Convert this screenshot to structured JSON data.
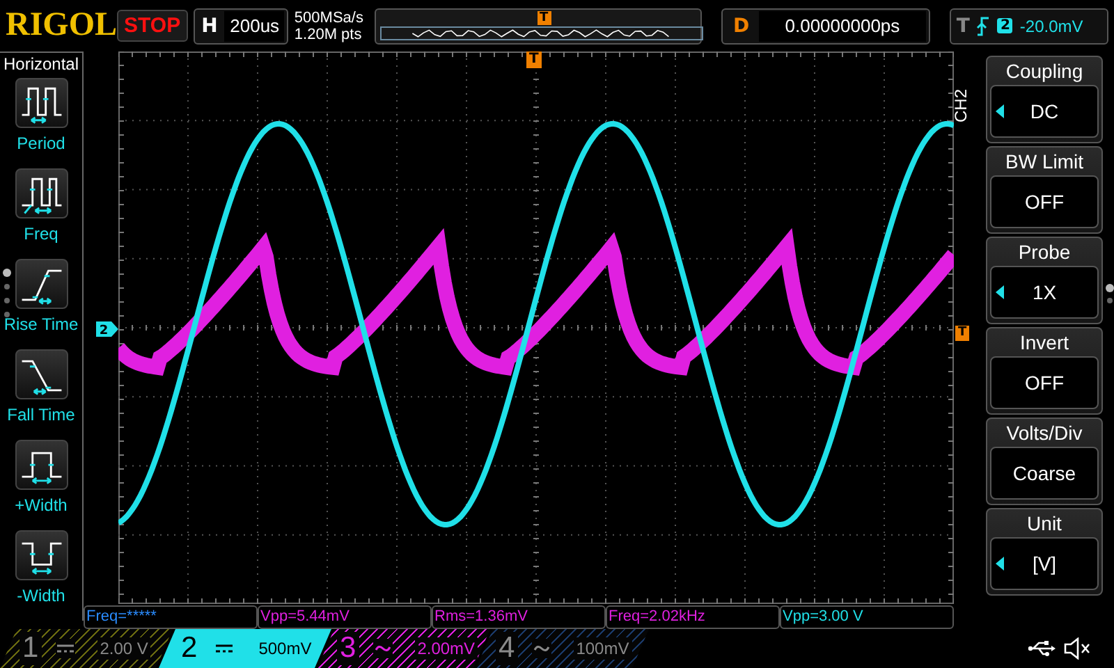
{
  "top_bar": {
    "logo": "RIGOL",
    "run_state": "STOP",
    "timebase": {
      "label": "H",
      "value": "200us"
    },
    "sample_rate": "500MSa/s",
    "memory_depth": "1.20M pts",
    "memory_trigger_marker": "T",
    "delay": {
      "label": "D",
      "value": "0.00000000ps"
    },
    "trigger": {
      "label": "T",
      "source": "2",
      "level": "-20.0mV"
    }
  },
  "left_menu": {
    "title": "Horizontal",
    "items": [
      {
        "kind": "period",
        "label": "Period"
      },
      {
        "kind": "freq",
        "label": "Freq"
      },
      {
        "kind": "rise",
        "label": "Rise Time"
      },
      {
        "kind": "fall",
        "label": "Fall Time"
      },
      {
        "kind": "pwidth",
        "label": "+Width"
      },
      {
        "kind": "nwidth",
        "label": "-Width"
      }
    ]
  },
  "plot": {
    "trigger_position_marker": "T",
    "trigger_level_marker": "T",
    "channel_marker": "2"
  },
  "right_menu": {
    "title": "CH2",
    "items": [
      {
        "label": "Coupling",
        "value": "DC",
        "arrow": true
      },
      {
        "label": "BW Limit",
        "value": "OFF",
        "arrow": false
      },
      {
        "label": "Probe",
        "value": "1X",
        "arrow": true
      },
      {
        "label": "Invert",
        "value": "OFF",
        "arrow": false
      },
      {
        "label": "Volts/Div",
        "value": "Coarse",
        "arrow": false
      },
      {
        "label": "Unit",
        "value": "[V]",
        "arrow": true
      }
    ]
  },
  "measurements": [
    {
      "text": "Freq=*****",
      "color": "#2a8cff"
    },
    {
      "text": "Vpp=5.44mV",
      "color": "#e020e0"
    },
    {
      "text": "Rms=1.36mV",
      "color": "#e020e0"
    },
    {
      "text": "Freq=2.02kHz",
      "color": "#e020e0"
    },
    {
      "text": "Vpp=3.00 V",
      "color": "#20e0e8"
    }
  ],
  "channels": [
    {
      "number": "1",
      "kind": "dc",
      "scale": "2.00 V",
      "color": "#6a6a10",
      "on": false,
      "selected": false
    },
    {
      "number": "2",
      "kind": "dc",
      "scale": "500mV",
      "color": "#20e0e8",
      "on": true,
      "selected": true
    },
    {
      "number": "3",
      "kind": "ac",
      "scale": "2.00mV",
      "color": "#e020e0",
      "on": true,
      "selected": false
    },
    {
      "number": "4",
      "kind": "ac",
      "scale": "100mV",
      "color": "#1a3a6a",
      "on": false,
      "selected": false
    }
  ]
}
